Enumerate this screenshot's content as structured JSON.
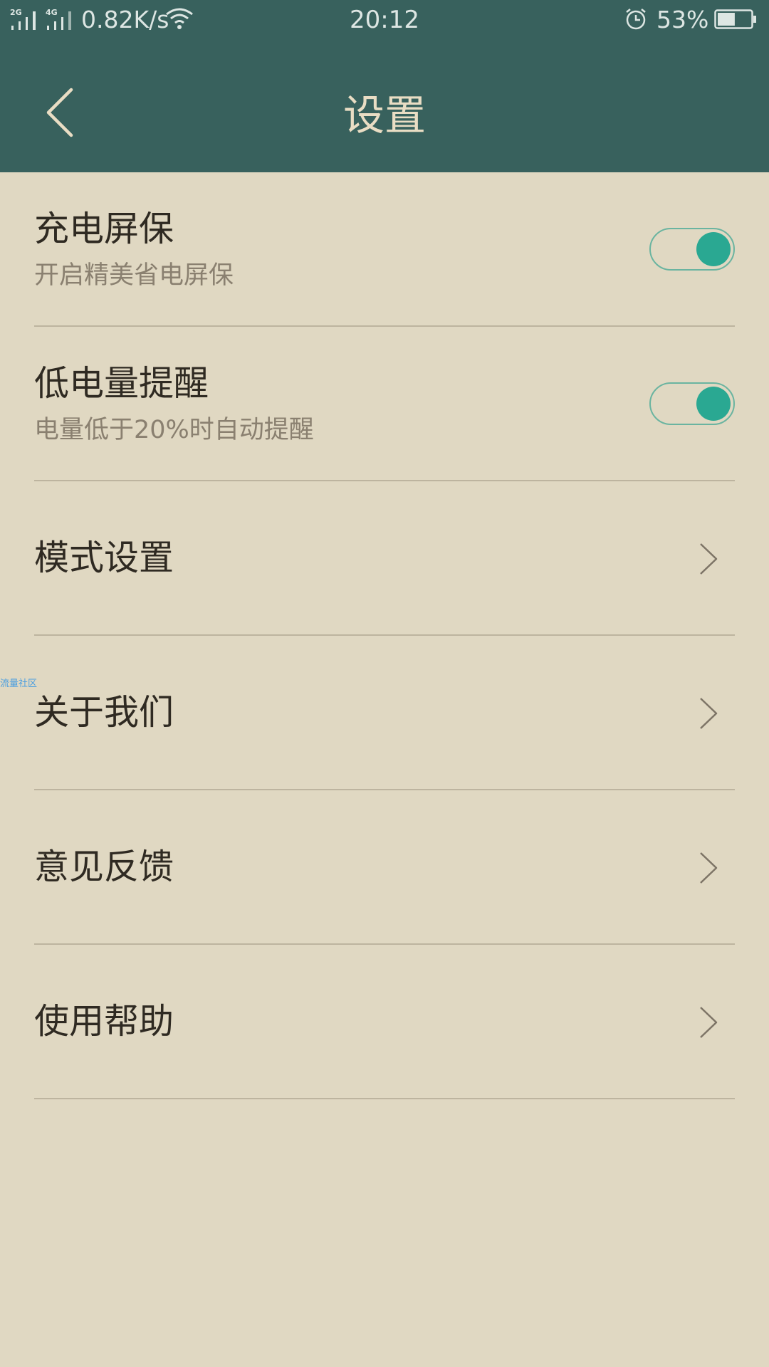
{
  "status_bar": {
    "signal_1_label": "2G",
    "signal_2_label": "4G",
    "net_speed": "0.82K/s",
    "time": "20:12",
    "battery_percent": "53%",
    "battery_level": 0.53,
    "icons": [
      "signal-icon",
      "wifi-icon",
      "alarm-icon",
      "battery-icon"
    ]
  },
  "header": {
    "title": "设置",
    "back_icon": "chevron-left-icon"
  },
  "settings": {
    "items": [
      {
        "title": "充电屏保",
        "subtitle": "开启精美省电屏保",
        "control": "toggle",
        "enabled": true
      },
      {
        "title": "低电量提醒",
        "subtitle": "电量低于20%时自动提醒",
        "control": "toggle",
        "enabled": true
      },
      {
        "title": "模式设置",
        "control": "chevron-right-icon"
      },
      {
        "title": "关于我们",
        "control": "chevron-right-icon"
      },
      {
        "title": "意见反馈",
        "control": "chevron-right-icon"
      },
      {
        "title": "使用帮助",
        "control": "chevron-right-icon"
      }
    ]
  },
  "watermark": "流量社区",
  "colors": {
    "header_bg": "#38615d",
    "page_bg": "#e0d8c2",
    "toggle_on": "#2aa892",
    "title_text": "#2f2a22",
    "subtitle_text": "#8a8070"
  }
}
